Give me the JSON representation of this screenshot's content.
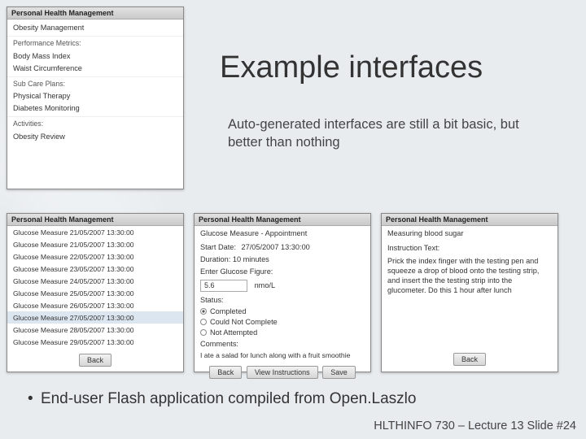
{
  "slide": {
    "title": "Example interfaces",
    "subtitle": "Auto-generated interfaces are still a bit basic, but better than nothing",
    "bullet": "End-user Flash application compiled from Open.Laszlo",
    "footer": "HLTHINFO 730 – Lecture 13 Slide #24"
  },
  "windowTitle": "Personal Health Management",
  "panel1": {
    "condition": "Obesity Management",
    "metricsLabel": "Performance Metrics:",
    "metrics": [
      "Body Mass Index",
      "Waist Circumference"
    ],
    "plansLabel": "Sub Care Plans:",
    "plans": [
      "Physical Therapy",
      "Diabetes Monitoring"
    ],
    "activitiesLabel": "Activities:",
    "activities": [
      "Obesity Review"
    ]
  },
  "panel2": {
    "items": [
      "Glucose Measure 21/05/2007 13:30:00",
      "Glucose Measure 21/05/2007 13:30:00",
      "Glucose Measure 22/05/2007 13:30:00",
      "Glucose Measure 23/05/2007 13:30:00",
      "Glucose Measure 24/05/2007 13:30:00",
      "Glucose Measure 25/05/2007 13:30:00",
      "Glucose Measure 26/05/2007 13:30:00",
      "Glucose Measure 27/05/2007 13:30:00",
      "Glucose Measure 28/05/2007 13:30:00",
      "Glucose Measure 29/05/2007 13:30:00"
    ],
    "selectedIndex": 7,
    "back": "Back"
  },
  "panel3": {
    "heading": "Glucose Measure - Appointment",
    "startLabel": "Start Date:",
    "startValue": "27/05/2007 13:30:00",
    "durationLabel": "Duration:  10 minutes",
    "enterLabel": "Enter Glucose Figure:",
    "value": "5.6",
    "unit": "nmo/L",
    "statusLabel": "Status:",
    "statuses": [
      "Completed",
      "Could Not Complete",
      "Not Attempted"
    ],
    "selectedStatus": 0,
    "commentsLabel": "Comments:",
    "comments": "I ate a salad for lunch along with a fruit smoothie",
    "buttons": [
      "Back",
      "View Instructions",
      "Save"
    ]
  },
  "panel4": {
    "heading": "Measuring blood sugar",
    "instrLabel": "Instruction Text:",
    "instr": "Prick the index finger with the testing pen and squeeze a drop of blood onto the testing strip, and insert the the testing strip into the glucometer. Do this 1 hour after lunch",
    "back": "Back"
  }
}
